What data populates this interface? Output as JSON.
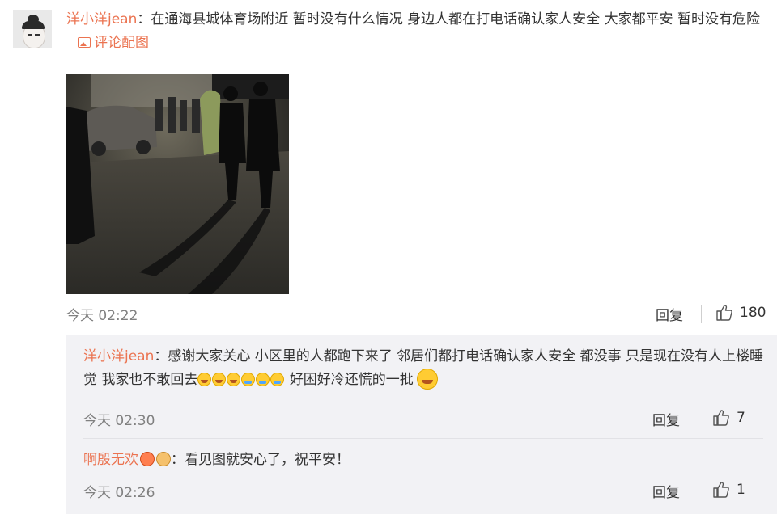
{
  "main_comment": {
    "username": "洋小洋jean",
    "separator": "：",
    "text": "在通海县城体育场附近 暂时没有什么情况 身边人都在打电话确认家人安全 大家都平安 暂时没有危险",
    "image_link": "评论配图",
    "time": "今天 02:22",
    "reply_label": "回复",
    "likes": "180"
  },
  "replies": [
    {
      "username": "洋小洋jean",
      "separator": "：",
      "text": "感谢大家关心 小区里的人都跑下来了 邻居们都打电话确认家人安全 都没事 只是现在没有人上楼睡觉 我家也不敢回去",
      "text_after_emoji": "好困好冷还慌的一批",
      "time": "今天 02:30",
      "reply_label": "回复",
      "likes": "7"
    },
    {
      "username": "啊殷无欢",
      "separator": "：",
      "text": "看见图就安心了，祝平安！",
      "time": "今天 02:26",
      "reply_label": "回复",
      "likes": "1"
    }
  ],
  "colors": {
    "link": "#eb7350",
    "muted": "#808080",
    "sub_bg": "#f2f2f5"
  }
}
